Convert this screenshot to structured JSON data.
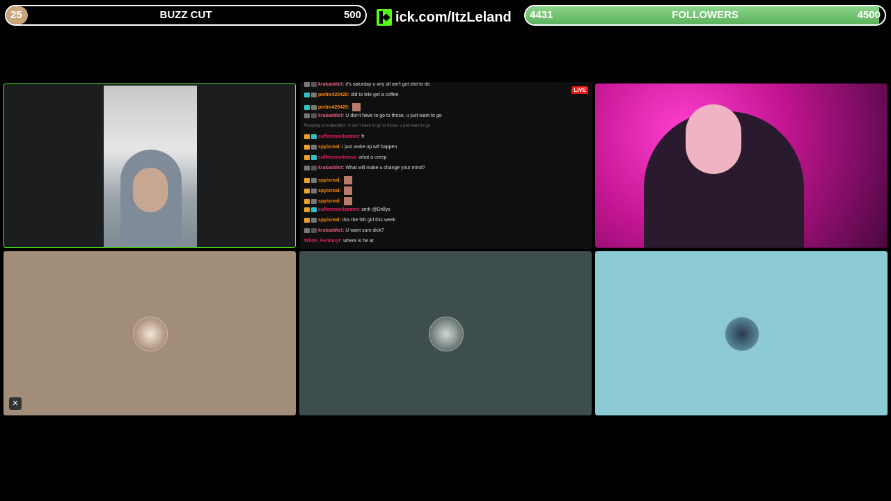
{
  "goal_left": {
    "count": "25",
    "label": "BUZZ CUT",
    "target": "500",
    "progress": 0.05
  },
  "brand": {
    "url": "ick.com/ItzLeland"
  },
  "goal_right": {
    "count": "4431",
    "label": "FOLLOWERS",
    "target": "4500",
    "progress": 0.985
  },
  "chat": {
    "live_label": "LIVE",
    "messages": [
      {
        "user": "krakaddict:",
        "text": "it's saturday u wry all ain't got shit to do",
        "color": "#e05c7a",
        "badges": [
          "#777",
          "#555"
        ]
      },
      {
        "user": "pedro420420:",
        "text": "did to lele get a coffee",
        "color": "#ff8a00",
        "badges": [
          "#2ec4c4",
          "#777"
        ]
      },
      {
        "user": "pedro420420:",
        "text": "",
        "color": "#ff8a00",
        "badges": [
          "#2ec4c4",
          "#777"
        ],
        "emote": true
      },
      {
        "user": "krakaddict:",
        "text": "U don't have to go to those, u just want to go",
        "color": "#e05c7a",
        "badges": [
          "#777",
          "#555"
        ]
      },
      {
        "user": "",
        "text": "Replying to krakaddict: U don't have to go to those, u just want to go",
        "color": "#777",
        "badges": [],
        "reply": true
      },
      {
        "user": "cuffemmo0oemm:",
        "text": "fr",
        "color": "#e0245e",
        "badges": [
          "#e8a32c",
          "#2ec4c4"
        ]
      },
      {
        "user": "spyisreal:",
        "text": "i just woke up wtf happen",
        "color": "#ff8a00",
        "badges": [
          "#e8a32c",
          "#777"
        ]
      },
      {
        "user": "cuffemmotionss:",
        "text": "what a creep",
        "color": "#e0245e",
        "badges": [
          "#e8a32c",
          "#2ec4c4"
        ]
      },
      {
        "user": "krakaddict:",
        "text": "What will make u change your mind?",
        "color": "#e05c7a",
        "badges": [
          "#777",
          "#555"
        ]
      },
      {
        "user": "spyisreal:",
        "text": "",
        "color": "#ff8a00",
        "badges": [
          "#e8a32c",
          "#777"
        ],
        "emote": true
      },
      {
        "user": "spyisreal:",
        "text": "",
        "color": "#ff8a00",
        "badges": [
          "#e8a32c",
          "#777"
        ],
        "emote": true
      },
      {
        "user": "spyisreal:",
        "text": "",
        "color": "#ff8a00",
        "badges": [
          "#e8a32c",
          "#777"
        ],
        "emote": true
      },
      {
        "user": "cuffemmo0oemm:",
        "text": "smh @Drillys",
        "color": "#e0245e",
        "badges": [
          "#e8a32c",
          "#2ec4c4"
        ]
      },
      {
        "user": "spyisreal:",
        "text": "this the 5th girl this week",
        "color": "#ff8a00",
        "badges": [
          "#e8a32c",
          "#777"
        ]
      },
      {
        "user": "krakaddict:",
        "text": "U want sum dick?",
        "color": "#e05c7a",
        "badges": [
          "#777",
          "#555"
        ]
      },
      {
        "user": "White_Fentanyl:",
        "text": "where is he at",
        "color": "#e0245e",
        "badges": []
      }
    ]
  },
  "tiles": {
    "tile4_color": "#a28c7a",
    "tile5_color": "#3e4e4c",
    "tile6_color": "#8ccad4",
    "mute_icon": "mic-off-icon"
  }
}
